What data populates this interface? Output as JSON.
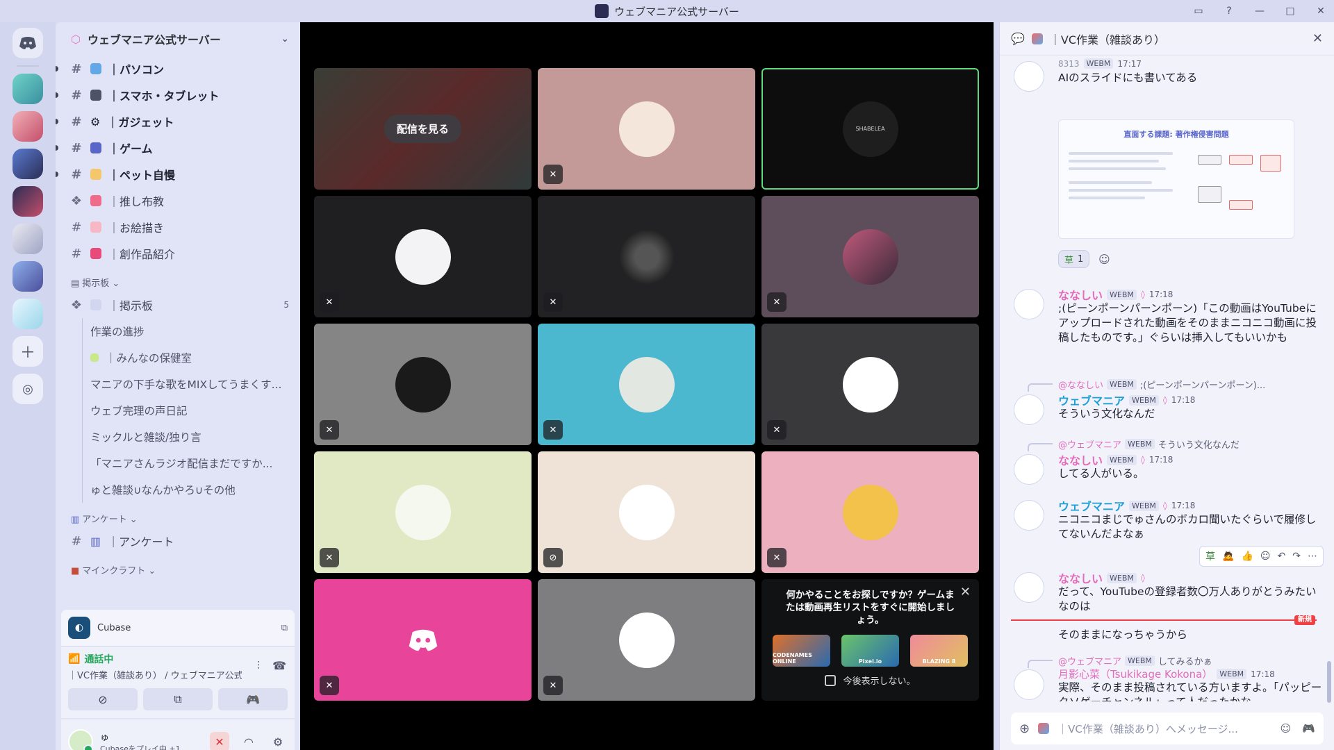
{
  "window": {
    "title": "ウェブマニア公式サーバー"
  },
  "server": {
    "name": "ウェブマニア公式サーバー"
  },
  "channels": [
    {
      "name": "｜パソコン",
      "type": "text",
      "unread": true
    },
    {
      "name": "｜スマホ・タブレット",
      "type": "text",
      "unread": true
    },
    {
      "name": "｜ガジェット",
      "type": "text",
      "unread": true
    },
    {
      "name": "｜ゲーム",
      "type": "text",
      "unread": true
    },
    {
      "name": "｜ペット自慢",
      "type": "text",
      "unread": true
    },
    {
      "name": "｜推し布教",
      "type": "forum",
      "unread": false
    },
    {
      "name": "｜お絵描き",
      "type": "text",
      "unread": false
    },
    {
      "name": "｜創作品紹介",
      "type": "text",
      "unread": false
    }
  ],
  "categories": {
    "board": "掲示板",
    "survey": "アンケート",
    "minecraft": "マインクラフト"
  },
  "board": {
    "name": "｜掲示板",
    "count": "5",
    "threads": [
      "作業の進捗",
      "｜みんなの保健室",
      "マニアの下手な歌をMIXしてうまくす...",
      "ウェブ完理の声日記",
      "ミックルと雑談/独り言",
      "「マニアさんラジオ配信まだですか...",
      "ゅと雑談∪なんかやろ∪その他"
    ]
  },
  "survey_channel": "｜アンケート",
  "activity": {
    "app": "Cubase"
  },
  "voice": {
    "status": "通話中",
    "channel": "｜VC作業（雑談あり） / ウェブマニア公式サ..."
  },
  "user": {
    "name": "ゅ",
    "status": "Cubaseをプレイ中 +1"
  },
  "stage": {
    "watch_label": "配信を見る",
    "tile_text_shabelea": "SHABELEA",
    "promo": {
      "text": "何かやることをお探しですか？ゲームまたは動画再生リストをすぐに開始しましょう。",
      "games": [
        "CODENAMES ONLINE",
        "Pixel.io",
        "BLAZING 8"
      ],
      "checkbox": "今後表示しない。"
    }
  },
  "chat": {
    "channel": "｜VC作業（雑談あり）",
    "placeholder": "｜VC作業（雑談あり）へメッセージ...",
    "messages": [
      {
        "author": "8313",
        "tag": "WEBM",
        "time": "17:17",
        "text": "AIのスライドにも書いてある"
      },
      {
        "author": "ななしい",
        "tag": "WEBM",
        "time": "17:18",
        "text": ";(ピーンポーンパーンポーン)「この動画はYouTubeにアップロードされた動画をそのままニコニコ動画に投稿したものです。」ぐらいは挿入してもいいかも"
      },
      {
        "reply_to": "@ななしい",
        "reply_tag": "WEBM",
        "reply_text": ";(ピーンポーンパーンポーン)...",
        "author": "ウェブマニア",
        "tag": "WEBM",
        "time": "17:18",
        "text": "そういう文化なんだ"
      },
      {
        "reply_to": "@ウェブマニア",
        "reply_tag": "WEBM",
        "reply_text": "そういう文化なんだ",
        "author": "ななしい",
        "tag": "WEBM",
        "time": "17:18",
        "text": "してる人がいる。"
      },
      {
        "author": "ウェブマニア",
        "tag": "WEBM",
        "time": "17:18",
        "text": "ニコニコまじでゅさんのボカロ聞いたぐらいで履修してないんだよなぁ"
      },
      {
        "author": "ななしい",
        "tag": "WEBM",
        "time": "",
        "text": "だって、YouTubeの登録者数〇万人ありがとうみたいなのは"
      },
      {
        "text": "そのままになっちゃうから"
      },
      {
        "reply_to": "@ウェブマニア",
        "reply_tag": "WEBM",
        "reply_text": "してみるかぁ",
        "author": "月影心菜（Tsukikage Kokona）",
        "tag": "WEBM",
        "time": "17:18",
        "text": "実際、そのまま投稿されている方いますよ。「パッピークソゲーチャンネル」って人だったかな。"
      }
    ],
    "slide_title": "直面する課題: 著作権侵害問題",
    "reaction_count": "1",
    "new_label": "新規"
  },
  "colors": {
    "accent_pink": "#e36bbb",
    "accent_blue": "#1ea0d7",
    "speaking_green": "#5fd87e",
    "new_red": "#f23f43"
  }
}
